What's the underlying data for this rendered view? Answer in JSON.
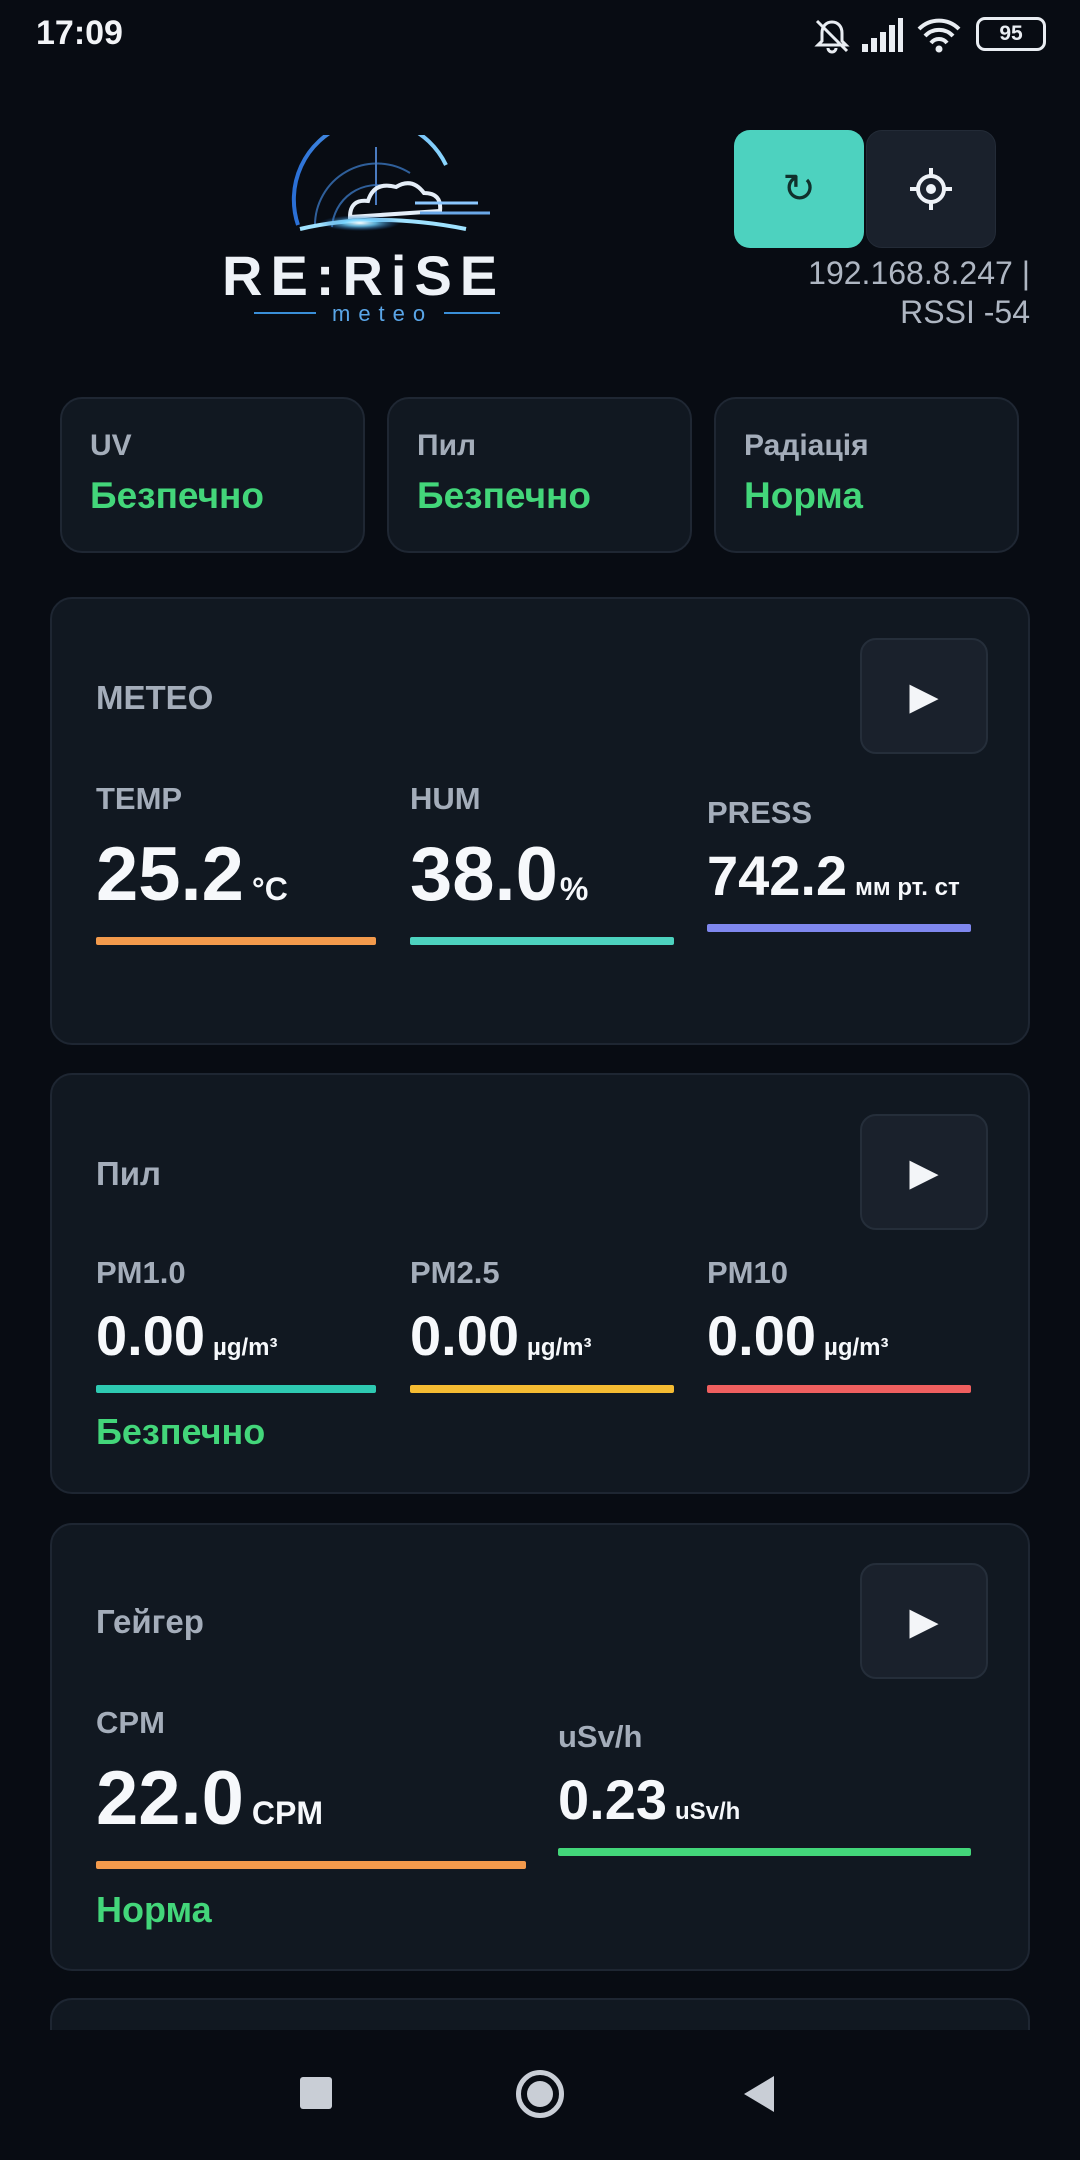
{
  "status_bar": {
    "time": "17:09",
    "battery": "95",
    "icons": [
      "mute-icon",
      "signal-icon",
      "wifi-icon",
      "battery-icon"
    ]
  },
  "header": {
    "logo_text": "RE:RiSE",
    "logo_subtext": "meteo",
    "refresh_icon": "↻",
    "settings_icon": "gear-icon",
    "ip": "192.168.8.247 |",
    "rssi": "RSSI -54"
  },
  "chips": [
    {
      "label": "UV",
      "value": "Безпечно"
    },
    {
      "label": "Пил",
      "value": "Безпечно"
    },
    {
      "label": "Радіація",
      "value": "Норма"
    }
  ],
  "meteo": {
    "title": "METEO",
    "play": "▶",
    "metrics": [
      {
        "label": "TEMP",
        "value": "25.2",
        "unit": "°C",
        "color": "#f39a4c"
      },
      {
        "label": "HUM",
        "value": "38.0",
        "unit": "%",
        "color": "#4dd2bf"
      },
      {
        "label": "PRESS",
        "value": "742.2",
        "unit": "мм рт. ст",
        "color": "#7f87ee"
      }
    ]
  },
  "dust": {
    "title": "Пил",
    "play": "▶",
    "metrics": [
      {
        "label": "PM1.0",
        "value": "0.00",
        "unit": "µg/m³",
        "color": "#2ec9b2"
      },
      {
        "label": "PM2.5",
        "value": "0.00",
        "unit": "µg/m³",
        "color": "#f5bb32"
      },
      {
        "label": "PM10",
        "value": "0.00",
        "unit": "µg/m³",
        "color": "#ef5f5f"
      }
    ],
    "status": "Безпечно"
  },
  "geiger": {
    "title": "Гейгер",
    "play": "▶",
    "metrics": [
      {
        "label": "CPM",
        "value": "22.0",
        "unit": "CPM",
        "color": "#f39a4c"
      },
      {
        "label": "uSv/h",
        "value": "0.23",
        "unit": "uSv/h",
        "color": "#43d67a"
      }
    ],
    "status": "Норма"
  },
  "colors": {
    "background": "#080c13",
    "card": "#111821",
    "accent": "#4dd2bf",
    "ok": "#43d67a"
  }
}
